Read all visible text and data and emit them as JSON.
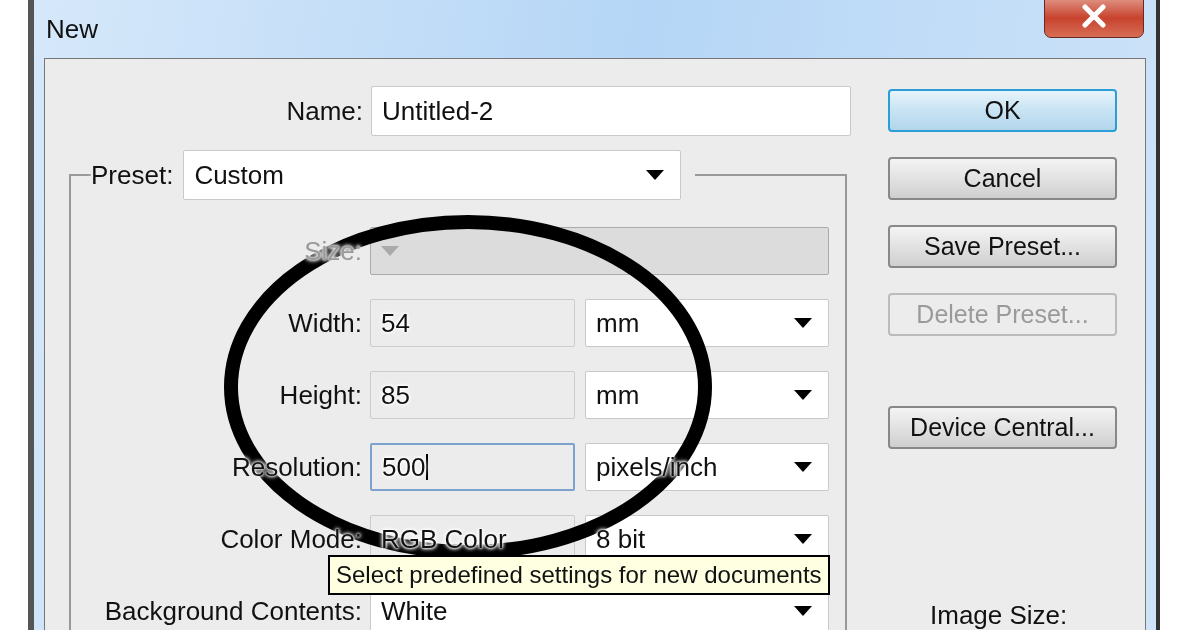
{
  "window": {
    "title": "New"
  },
  "name_field": {
    "label": "Name:",
    "value": "Untitled-2"
  },
  "preset": {
    "label": "Preset:",
    "value": "Custom"
  },
  "rows": [
    {
      "kind": "select",
      "label": "Size:",
      "disabled": true
    },
    {
      "kind": "value_unit",
      "label": "Width:",
      "value": "54",
      "unit": "mm",
      "focused": false
    },
    {
      "kind": "value_unit",
      "label": "Height:",
      "value": "85",
      "unit": "mm",
      "focused": false
    },
    {
      "kind": "value_unit",
      "label": "Resolution:",
      "value": "500",
      "unit": "pixels/inch",
      "focused": true
    },
    {
      "kind": "value_unit",
      "label": "Color Mode:",
      "value": "RGB Color",
      "unit": "8 bit",
      "focused": false
    },
    {
      "kind": "select",
      "label": "Background Contents:",
      "value": "White",
      "disabled": false
    }
  ],
  "buttons": [
    {
      "label": "OK",
      "default": true,
      "disabled": false
    },
    {
      "label": "Cancel",
      "default": false,
      "disabled": false
    },
    {
      "label": "Save Preset...",
      "default": false,
      "disabled": false
    },
    {
      "label": "Delete Preset...",
      "default": false,
      "disabled": true
    },
    {
      "label": "Device Central...",
      "default": false,
      "disabled": false
    }
  ],
  "tooltip": "Select predefined settings for new documents",
  "image_size_label": "Image Size:"
}
